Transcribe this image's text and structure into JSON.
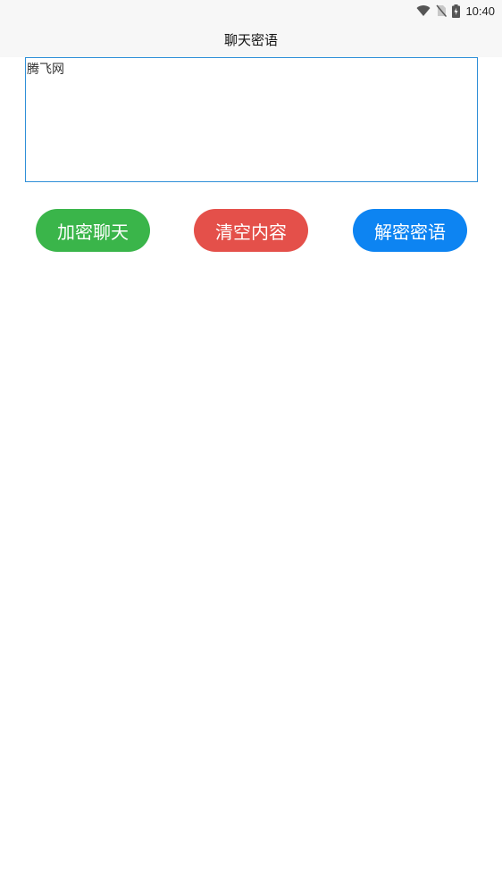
{
  "status_bar": {
    "time": "10:40",
    "icons": [
      "wifi-icon",
      "no-sim-icon",
      "battery-charging-icon"
    ]
  },
  "header": {
    "title": "聊天密语"
  },
  "editor": {
    "value": "腾飞网"
  },
  "actions": {
    "encrypt_label": "加密聊天",
    "clear_label": "清空内容",
    "decrypt_label": "解密密语"
  },
  "colors": {
    "encrypt": "#3ab54a",
    "clear": "#e4504a",
    "decrypt": "#0d84f2",
    "textarea_border": "#2f8fd8"
  }
}
